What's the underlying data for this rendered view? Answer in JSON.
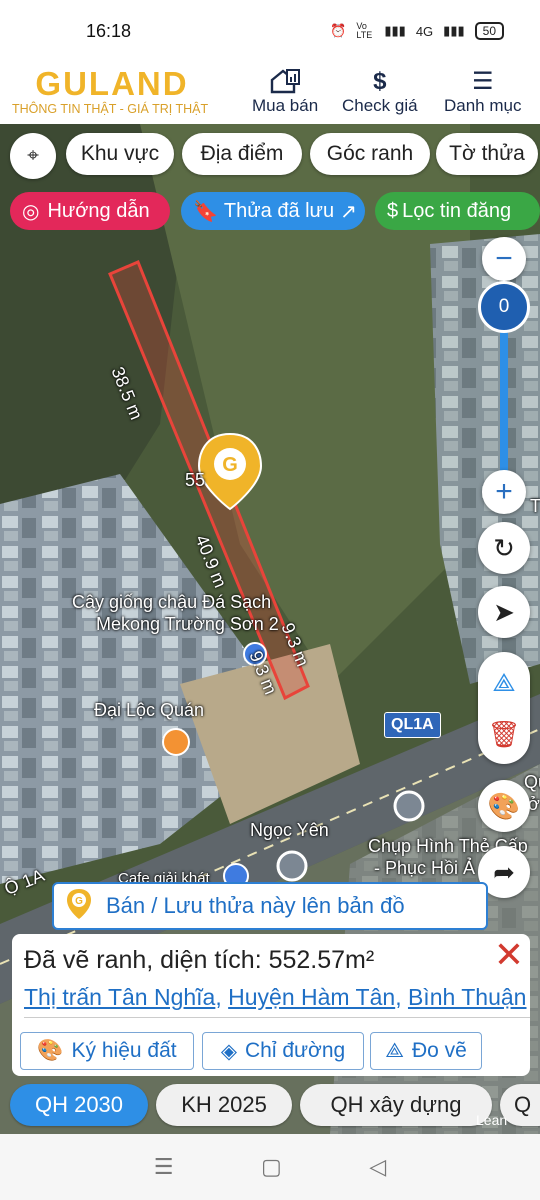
{
  "status": {
    "time": "16:18",
    "volte": "Vo LTE",
    "net": "4G",
    "battery": "50"
  },
  "header": {
    "logo": "GULAND",
    "tagline": "THÔNG TIN THẬT - GIÁ TRỊ THẬT",
    "nav": [
      {
        "label": "Mua bán",
        "icon": "house-chart-icon"
      },
      {
        "label": "Check giá",
        "icon": "dollar-icon",
        "glyph": "$"
      },
      {
        "label": "Danh mục",
        "icon": "menu-icon",
        "glyph": "☰"
      }
    ]
  },
  "filters": [
    "Khu vực",
    "Địa điểm",
    "Góc ranh",
    "Tờ thửa"
  ],
  "actions": {
    "guide": "Hướng dẫn",
    "saved": "Thửa đã lưu",
    "filter": "Lọc tin đăng"
  },
  "map": {
    "zoom_value": "0",
    "dimensions": [
      "38.5 m",
      "40.9 m",
      "9.3 m",
      "9.3 m"
    ],
    "area_label_partial": "55",
    "pois": [
      "Cây giống chậu Đá Sạch",
      "Mekong Trường Sơn 2",
      "Đại Lộc Quán",
      "Ngọc Yên",
      "Chụp Hình Thẻ Cấp",
      "- Phục Hồi Ả",
      "Cafe giải khát"
    ],
    "road_badge": "QL1A",
    "road_text": "Ộ 1A",
    "edge_text": [
      "Quả",
      "ở",
      "T"
    ],
    "colors": {
      "parcel": "#e8443a",
      "accent": "#1f6fc5",
      "brand": "#f0b429"
    }
  },
  "save_bar": {
    "label": "Bán / Lưu thửa này lên bản đồ"
  },
  "panel": {
    "title": "Đã vẽ ranh, diện tích: 552.57m²",
    "address": [
      "Thị trấn Tân Nghĩa",
      "Huyện Hàm Tân",
      "Bình Thuận"
    ],
    "buttons": [
      "Ký hiệu đất",
      "Chỉ đường",
      "Đo vẽ"
    ]
  },
  "plan_tabs": [
    "QH 2030",
    "KH 2025",
    "QH xây dựng",
    "Q"
  ],
  "watermark": "Lean"
}
